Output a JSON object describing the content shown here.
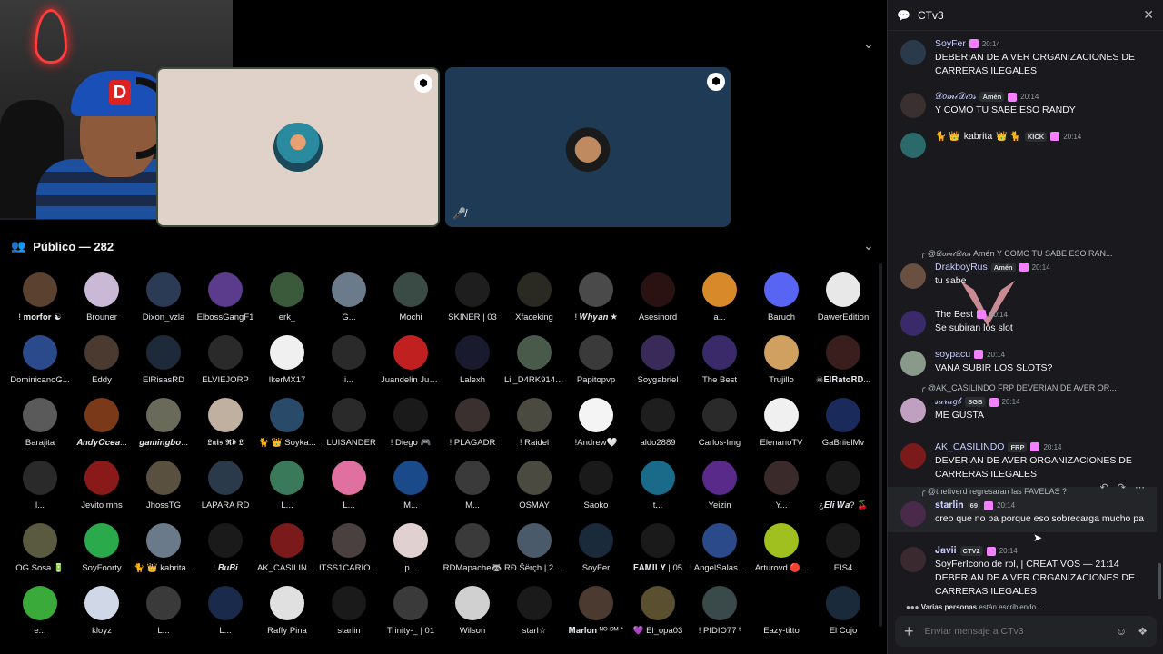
{
  "stage": {
    "audience_label": "Público — 282"
  },
  "audience": [
    {
      "name": "! 𝐦𝐨𝐫𝐟𝐨𝐫 ☯",
      "color": "#5b4230"
    },
    {
      "name": "Brouner",
      "color": "#c9b8d6"
    },
    {
      "name": "Dixon_vzla",
      "color": "#2b3a55"
    },
    {
      "name": "ElbossGangF1",
      "color": "#5a3b8c"
    },
    {
      "name": "erk_",
      "color": "#3b5a3b"
    },
    {
      "name": "G...",
      "color": "#6b7b8c"
    },
    {
      "name": "Mochi",
      "color": "#3a4a45"
    },
    {
      "name": "SKINER | 03",
      "color": "#1e1e1e"
    },
    {
      "name": "Xfaceking",
      "color": "#2a2a22"
    },
    {
      "name": "! 𝑾𝒉𝒚𝒂𝒏 ★",
      "color": "#4a4a4a"
    },
    {
      "name": "Asesinord",
      "color": "#2a1212"
    },
    {
      "name": "a...",
      "color": "#d88a2a"
    },
    {
      "name": "Baruch",
      "color": "#5865f2"
    },
    {
      "name": "DawerEdition",
      "color": "#e8e8e8"
    },
    {
      "name": "DominicanoG...",
      "color": "#2a4a8c"
    },
    {
      "name": "Eddy",
      "color": "#4a3a30"
    },
    {
      "name": "ElRisasRD",
      "color": "#1e2a3a"
    },
    {
      "name": "ELVIEJORP",
      "color": "#2a2a2a"
    },
    {
      "name": "IkerMX17",
      "color": "#f0f0f0"
    },
    {
      "name": "i...",
      "color": "#2a2a2a"
    },
    {
      "name": "Juandelin Jue...",
      "color": "#c02020"
    },
    {
      "name": "Lalexh",
      "color": "#1a1a2e"
    },
    {
      "name": "Lil_D4RK914 ...",
      "color": "#4a5a4a"
    },
    {
      "name": "Papitopvp",
      "color": "#3a3a3a"
    },
    {
      "name": "Soygabriel",
      "color": "#3a2a5a"
    },
    {
      "name": "The Best",
      "color": "#3a2a6a"
    },
    {
      "name": "Trujillo",
      "color": "#d0a060"
    },
    {
      "name": "☠𝐄𝐥𝐑𝐚𝐭𝐨𝐑𝐃...",
      "color": "#3a1e1e"
    },
    {
      "name": "Barajita",
      "color": "#5a5a5a"
    },
    {
      "name": "𝑨𝒏𝒅𝒚𝑶𝒄𝒆𝒂...",
      "color": "#7a3a1a"
    },
    {
      "name": "𝒈𝒂𝒎𝒊𝒏𝒈𝒃𝒐...",
      "color": "#6a6a5a"
    },
    {
      "name": "𝕷𝖚𝖎𝖘 𝕽𝖉 𝕷",
      "color": "#c0b0a0"
    },
    {
      "name": "🐈 👑 Soyka...",
      "color": "#2a4a6a"
    },
    {
      "name": "! LUISANDER",
      "color": "#2a2a2a"
    },
    {
      "name": "! Diego 🎮",
      "color": "#1a1a1a"
    },
    {
      "name": "! PLAGADR",
      "color": "#3a3030"
    },
    {
      "name": "! Raidel",
      "color": "#4a4a40"
    },
    {
      "name": "!Andrew🤍",
      "color": "#f4f4f4"
    },
    {
      "name": "aldo2889",
      "color": "#1e1e1e"
    },
    {
      "name": "Carlos-Img",
      "color": "#2a2a2a"
    },
    {
      "name": "ElenanoTV",
      "color": "#f0f0f0"
    },
    {
      "name": "GaBriielMv",
      "color": "#1a2a5a"
    },
    {
      "name": "l...",
      "color": "#2a2a2a"
    },
    {
      "name": "Jevito mhs",
      "color": "#8a1a1a"
    },
    {
      "name": "JhossTG",
      "color": "#5a5040"
    },
    {
      "name": "LAPARA RD",
      "color": "#2a3a4a"
    },
    {
      "name": "L...",
      "color": "#3a7a5a"
    },
    {
      "name": "L...",
      "color": "#e070a0"
    },
    {
      "name": "M...",
      "color": "#1a4a8a"
    },
    {
      "name": "M...",
      "color": "#3a3a3a"
    },
    {
      "name": "OSMAY",
      "color": "#4a4a40"
    },
    {
      "name": "Saoko",
      "color": "#1a1a1a"
    },
    {
      "name": "t...",
      "color": "#1a6a8a"
    },
    {
      "name": "Yeizin",
      "color": "#5a2a8a"
    },
    {
      "name": "Y...",
      "color": "#3a2a2a"
    },
    {
      "name": "¿𝑬𝒍𝒊 𝑾𝒂? 🍒",
      "color": "#1a1a1a"
    },
    {
      "name": "OG Sosa 🔋",
      "color": "#5a5a40"
    },
    {
      "name": "SoyFoorty",
      "color": "#2aaa4a"
    },
    {
      "name": "🐈 👑 kabrita...",
      "color": "#6a7a8a"
    },
    {
      "name": "! 𝑩𝒖𝑩𝒊",
      "color": "#1a1a1a"
    },
    {
      "name": "AK_CASILINDO",
      "color": "#7a1a1a"
    },
    {
      "name": "ITSS1CARIO O...",
      "color": "#4a4040"
    },
    {
      "name": "p...",
      "color": "#e0d0d0"
    },
    {
      "name": "RDMapache🦝",
      "color": "#3a3a3a"
    },
    {
      "name": "RÐ Šërçh | 20 ...",
      "color": "#4a5a6a"
    },
    {
      "name": "SoyFer",
      "color": "#1a2a3a"
    },
    {
      "name": "𝐅𝐀𝐌𝐈𝐋𝐘 | 05",
      "color": "#1a1a1a"
    },
    {
      "name": "! AngelSalasRD",
      "color": "#2a4a8a"
    },
    {
      "name": "Arturovd 🔴...",
      "color": "#a0c020"
    },
    {
      "name": "EIS4",
      "color": "#1a1a1a"
    },
    {
      "name": "e...",
      "color": "#3aaa3a"
    },
    {
      "name": "kloyz",
      "color": "#d0d8e8"
    },
    {
      "name": "L...",
      "color": "#3a3a3a"
    },
    {
      "name": "L...",
      "color": "#1a2a4a"
    },
    {
      "name": "Raffy Pina",
      "color": "#e0e0e0"
    },
    {
      "name": "starlin",
      "color": "#1a1a1a"
    },
    {
      "name": "Trinity-_ | 01",
      "color": "#3a3a3a"
    },
    {
      "name": "Wilson",
      "color": "#d0d0d0"
    },
    {
      "name": "starl☆",
      "color": "#1a1a1a"
    },
    {
      "name": "𝐌𝐚𝐫𝐥𝐨𝐧 ᴺᴼ ᴰᴹ ⁺",
      "color": "#4a3a30"
    },
    {
      "name": "💜 El_opa03",
      "color": "#5a5030"
    },
    {
      "name": "! PIDIO77 ᵗ",
      "color": "#3a4a4a"
    },
    {
      "name": "Eazy-titto",
      "color": "#000000"
    },
    {
      "name": "El Cojo",
      "color": "#1a2a3a"
    }
  ],
  "chat": {
    "channel": "CTv3",
    "messages": [
      {
        "author": "SoyFer",
        "author_color": "#c9cdfb",
        "time": "20:14",
        "text": "DEBERIAN DE A VER ORGANIZACIONES  DE CARRERAS ILEGALES",
        "pfp": "#2a3a4a"
      },
      {
        "author": "𝒟𝑜𝓂𝒾𝒟𝒾𝑜𝓈",
        "author_color": "#c9cdfb",
        "tag": "Amén",
        "time": "20:14",
        "text": "Y COMO TU SABE ESO RANDY",
        "pfp": "#3a3030"
      },
      {
        "author": "kabrita",
        "author_color": "#f2f3f5",
        "prefix": "🐈 👑",
        "suffix": "👑 🐈",
        "tag": "KICK",
        "time": "20:14",
        "text": "",
        "pfp": "#2a6a6a"
      },
      {
        "reply": "@𝒟𝑜𝓂𝒾𝒟𝒾𝑜𝓈 Amén  Y COMO TU SABE ESO RAN...",
        "author": "DrakboyRus",
        "author_color": "#c9cdfb",
        "tag": "Amén",
        "time": "20:14",
        "text": "tu sabe",
        "pfp": "#6a5040"
      },
      {
        "author": "The Best",
        "author_color": "#f2f3f5",
        "time": "20:14",
        "text": "Se subiran los slot",
        "pfp": "#3a2a6a"
      },
      {
        "author": "soypacu",
        "author_color": "#c9cdfb",
        "time": "20:14",
        "text": "VANA SUBIR LOS SLOTS?",
        "pfp": "#8a9a8a"
      },
      {
        "reply": "@AK_CASILINDO  FRP  DEVERIAN DE AVER  OR...",
        "author": "𝓈𝒶𝓇𝒶𝑔𝒷",
        "author_color": "#c9cdfb",
        "tag": "SGB",
        "time": "20:14",
        "text": "ME GUSTA",
        "pfp": "#c0a0c0"
      },
      {
        "author": "AK_CASILINDO",
        "author_color": "#c9cdfb",
        "tag": "FRP",
        "time": "20:14",
        "text": "DEVERIAN DE AVER  ORGANIZACIONES  DE CARRERAS ILEGALES",
        "pfp": "#7a1a1a"
      },
      {
        "reply": "@thefiverd regresaran las FAVELAS ?",
        "author": "𝐬𝐭𝐚𝐫𝐥𝐢𝐧",
        "author_color": "#c9cdfb",
        "tag": "69",
        "time": "20:14",
        "text": "creo que no pa porque eso sobrecarga mucho pa",
        "pfp": "#4a2a4a"
      },
      {
        "author": "𝐉𝐚𝐯𝐢𝐢",
        "author_color": "#c9cdfb",
        "tag": "CTV2",
        "time": "20:14",
        "text": "SoyFerIcono de rol, | CREATIVOS — 21:14 DEBERIAN DE A VER ORGANIZACIONES  DE CARRERAS ILEGALES",
        "pfp": "#3a2a30"
      }
    ],
    "typing_who": "Varias personas",
    "typing_rest": " están escribiendo...",
    "composer_placeholder": "Enviar mensaje a CTv3"
  },
  "icons": {
    "channel": "chat-bubble-icon",
    "close": "close-icon",
    "audience": "people-icon",
    "chevron": "chevron-down-icon"
  }
}
